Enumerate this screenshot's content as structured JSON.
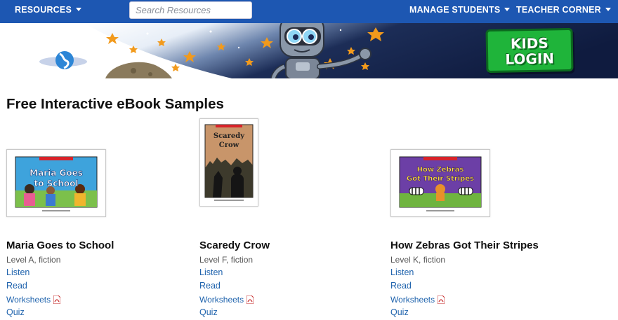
{
  "topnav": {
    "resources_label": "RESOURCES",
    "search_placeholder": "Search Resources",
    "manage_students_label": "MANAGE STUDENTS",
    "teacher_corner_label": "TEACHER CORNER"
  },
  "banner": {
    "kids_login_line1": "KIDS",
    "kids_login_line2": "LOGIN"
  },
  "page_title": "Free Interactive eBook Samples",
  "books": [
    {
      "title": "Maria Goes to School",
      "level": "Level A, fiction",
      "cover_title": "Maria Goes to School",
      "cover_color": "#2e9bd6",
      "listen": "Listen",
      "read": "Read",
      "worksheets": "Worksheets",
      "quiz": "Quiz"
    },
    {
      "title": "Scaredy Crow",
      "level": "Level F, fiction",
      "cover_title": "Scaredy Crow",
      "cover_color": "#c8956a",
      "listen": "Listen",
      "read": "Read",
      "worksheets": "Worksheets",
      "quiz": "Quiz"
    },
    {
      "title": "How Zebras Got Their Stripes",
      "level": "Level K, fiction",
      "cover_title": "How Zebras Got Their Stripes",
      "cover_color": "#6c3fa6",
      "listen": "Listen",
      "read": "Read",
      "worksheets": "Worksheets",
      "quiz": "Quiz"
    }
  ],
  "colors": {
    "nav_bg": "#1d57b2",
    "link": "#1f63ad",
    "kids_login_green": "#1fb43a"
  }
}
